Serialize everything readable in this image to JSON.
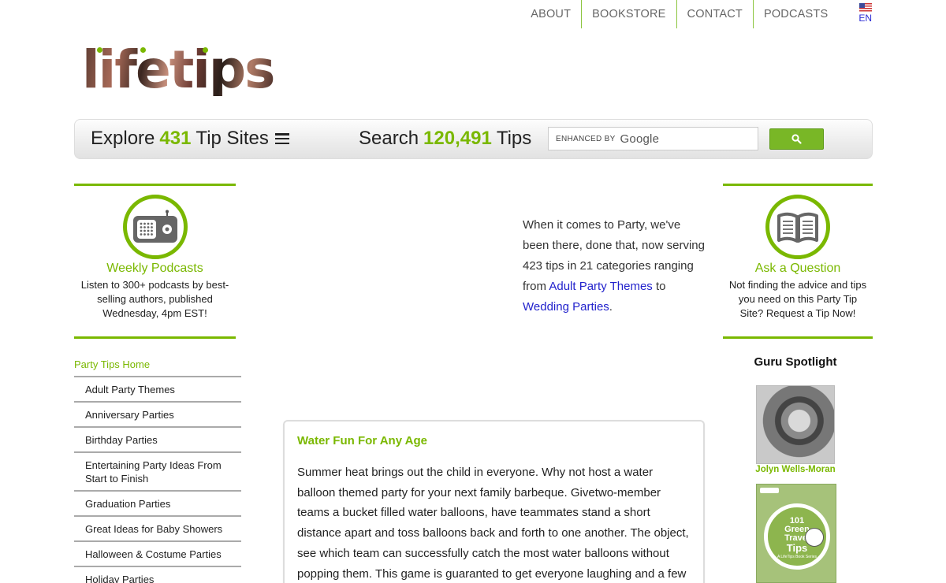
{
  "topnav": {
    "items": [
      "ABOUT",
      "BOOKSTORE",
      "CONTACT",
      "PODCASTS"
    ],
    "lang": "EN"
  },
  "logo": {
    "text": "lifetips"
  },
  "searchbar": {
    "explore_prefix": "Explore",
    "explore_count": "431",
    "explore_suffix": "Tip Sites",
    "search_prefix": "Search",
    "search_count": "120,491",
    "search_suffix": "Tips",
    "enhanced_by": "ENHANCED BY",
    "google": "Google"
  },
  "left_promo": {
    "title": "Weekly Podcasts",
    "text": "Listen to 300+ podcasts by best-selling authors, published Wednesday, 4pm EST!"
  },
  "right_promo": {
    "title": "Ask a Question",
    "text": "Not finding the advice and tips you need on this Party Tip Site? Request a Tip Now!"
  },
  "sidenav": {
    "home": "Party Tips Home",
    "items": [
      "Adult Party Themes",
      "Anniversary Parties",
      "Birthday Parties",
      "Entertaining Party Ideas From Start to Finish",
      "Graduation Parties",
      "Great Ideas for Baby Showers",
      "Halloween & Costume Parties",
      "Holiday Parties"
    ]
  },
  "intro": {
    "text_before": "When it comes to Party, we've been there, done that, now serving 423 tips in 21 categories ranging from ",
    "link1": "Adult Party Themes",
    "text_middle": " to ",
    "link2": "Wedding Parties",
    "text_after": "."
  },
  "tip": {
    "title": "Water Fun For Any Age",
    "body": "Summer heat brings out the child in everyone. Why not host a water balloon themed party for your next family barbeque. Givetwo-member teams a bucket filled water balloons, have teammates stand a short distance apart and toss balloons back and forth to one another. The object, see which team can successfully catch the most water balloons without popping them. This game is guaranted to get everyone laughing and a few"
  },
  "guru": {
    "title": "Guru Spotlight",
    "name": "Jolyn Wells-Moran"
  },
  "book": {
    "line1": "101",
    "line2": "Green",
    "line3": "Travel",
    "line4": "Tips",
    "line5": "A LifeTips Book Series"
  },
  "colors": {
    "accent": "#7ab800",
    "link": "#2222cc"
  }
}
